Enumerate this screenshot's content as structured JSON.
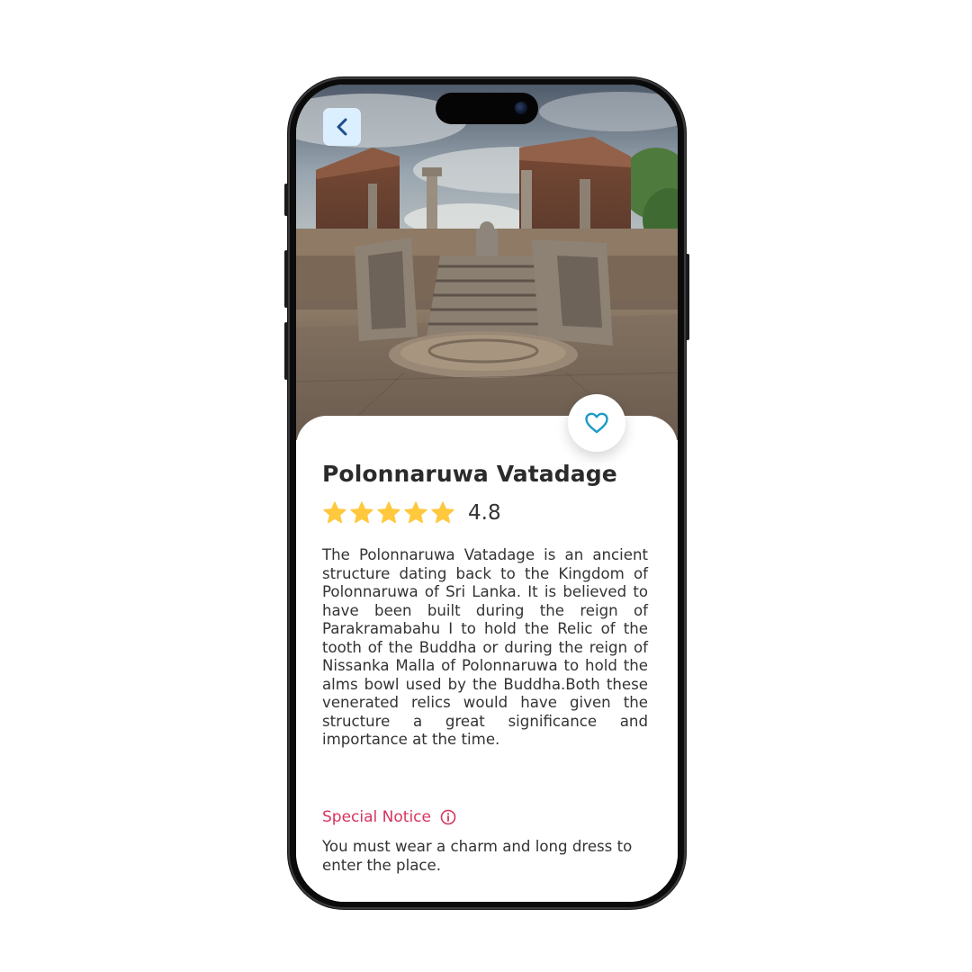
{
  "place": {
    "title": "Polonnaruwa Vatadage",
    "rating_value": "4.8",
    "rating_stars": 5,
    "description": "The Polonnaruwa Vatadage is an ancient structure dating back to the Kingdom of Polonnaruwa of Sri Lanka. It is believed to have been built during the reign of Parakramabahu I to hold the Relic of the tooth of the Buddha or during the reign of Nissanka Malla of Polonnaruwa to hold the alms bowl used by the Buddha.Both these venerated relics would have given the structure a great significance and importance at the time."
  },
  "notice": {
    "label": "Special Notice",
    "text": "You must wear a charm and long dress to enter the place."
  },
  "icons": {
    "back": "chevron-left-icon",
    "favorite": "heart-outline-icon",
    "star": "star-filled-icon",
    "info": "info-circle-icon"
  },
  "colors": {
    "star": "#FFC83D",
    "notice": "#D7345F",
    "accent": "#1E9BC6",
    "back_button_bg": "#DCEFFF",
    "back_chevron": "#1E4E8C"
  }
}
